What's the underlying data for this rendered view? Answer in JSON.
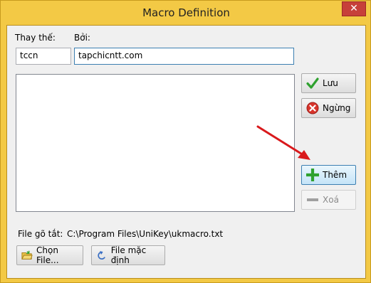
{
  "window": {
    "title": "Macro Definition",
    "close_glyph": "✕"
  },
  "form": {
    "replace_label": "Thay thế:",
    "replace_value": "tccn",
    "with_label": "Bởi:",
    "with_value": "tapchicntt.com"
  },
  "buttons": {
    "save": {
      "label": "Lưu",
      "icon": "green-check-icon"
    },
    "stop": {
      "label": "Ngừng",
      "icon": "red-x-icon"
    },
    "add": {
      "label": "Thêm",
      "icon": "green-plus-icon"
    },
    "delete": {
      "label": "Xoá",
      "icon": "gray-minus-icon",
      "disabled": true
    },
    "choose_file": {
      "label": "Chọn File...",
      "icon": "folder-icon"
    },
    "default_file": {
      "label": "File mặc định",
      "icon": "undo-arrow-icon"
    }
  },
  "file": {
    "label": "File gõ tắt:",
    "path": "C:\\Program Files\\UniKey\\ukmacro.txt"
  },
  "annotation": {
    "arrow_color": "#d9191c"
  }
}
